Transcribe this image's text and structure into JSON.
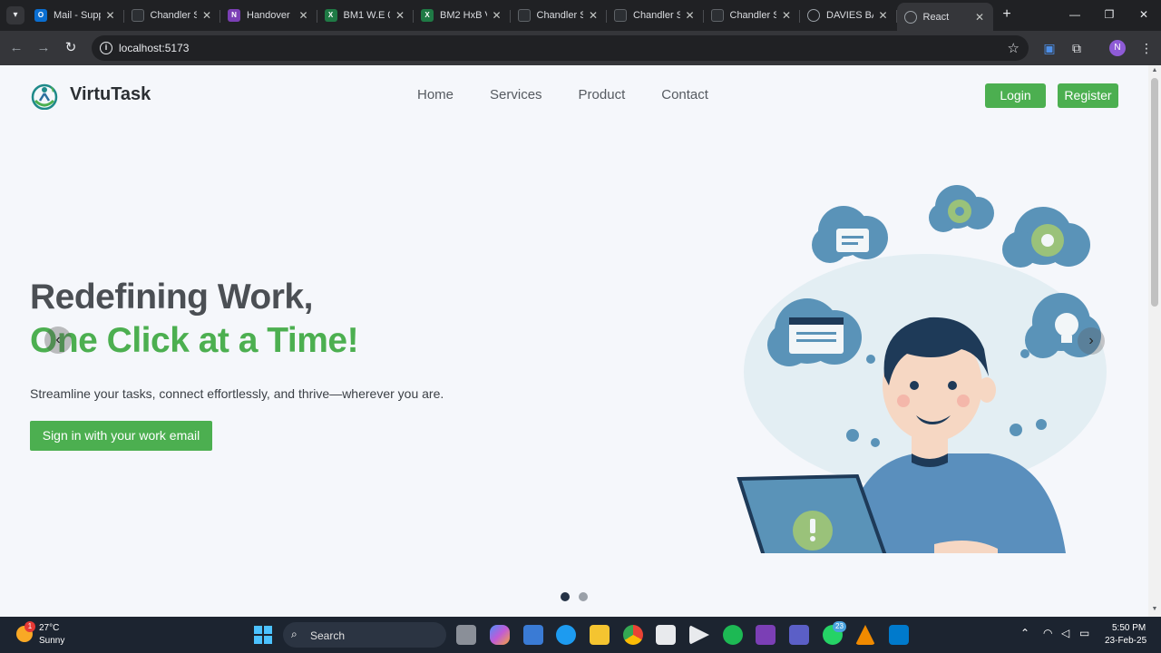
{
  "browser": {
    "tabs": [
      {
        "title": "Mail - Supp",
        "icon": "outlook-icon",
        "color": "#0a6ed1",
        "active": false
      },
      {
        "title": "Chandler S",
        "icon": "site-icon",
        "color": "#202124",
        "active": false
      },
      {
        "title": "Handover",
        "icon": "onenote-icon",
        "color": "#7b3fb5",
        "active": false
      },
      {
        "title": "BM1 W.E 0",
        "icon": "excel-icon",
        "color": "#1f7a45",
        "active": false
      },
      {
        "title": "BM2 HxB V",
        "icon": "excel-icon",
        "color": "#1f7a45",
        "active": false
      },
      {
        "title": "Chandler S",
        "icon": "site-icon",
        "color": "#202124",
        "active": false
      },
      {
        "title": "Chandler S",
        "icon": "site-icon",
        "color": "#202124",
        "active": false
      },
      {
        "title": "Chandler S",
        "icon": "site-icon",
        "color": "#202124",
        "active": false
      },
      {
        "title": "DAVIES BA",
        "icon": "globe-icon",
        "color": "#5f6368",
        "active": false
      },
      {
        "title": "React",
        "icon": "globe-icon",
        "color": "#5f6368",
        "active": true
      }
    ],
    "url": "localhost:5173",
    "profile_initial": "N"
  },
  "site": {
    "brand": "VirtuTask",
    "nav": [
      "Home",
      "Services",
      "Product",
      "Contact"
    ],
    "login_label": "Login",
    "register_label": "Register",
    "accent_color": "#4caf50"
  },
  "hero": {
    "title_line1": "Redefining Work,",
    "title_line2": "One Click at a Time!",
    "subtitle": "Streamline your tasks, connect effortlessly, and thrive—wherever you are.",
    "cta_label": "Sign in with your work email",
    "carousel_active": 1,
    "carousel_count": 2
  },
  "taskbar": {
    "weather_temp": "27°C",
    "weather_desc": "Sunny",
    "weather_badge": "1",
    "search_label": "Search",
    "whatsapp_badge": "23",
    "time": "5:50 PM",
    "date": "23-Feb-25"
  }
}
